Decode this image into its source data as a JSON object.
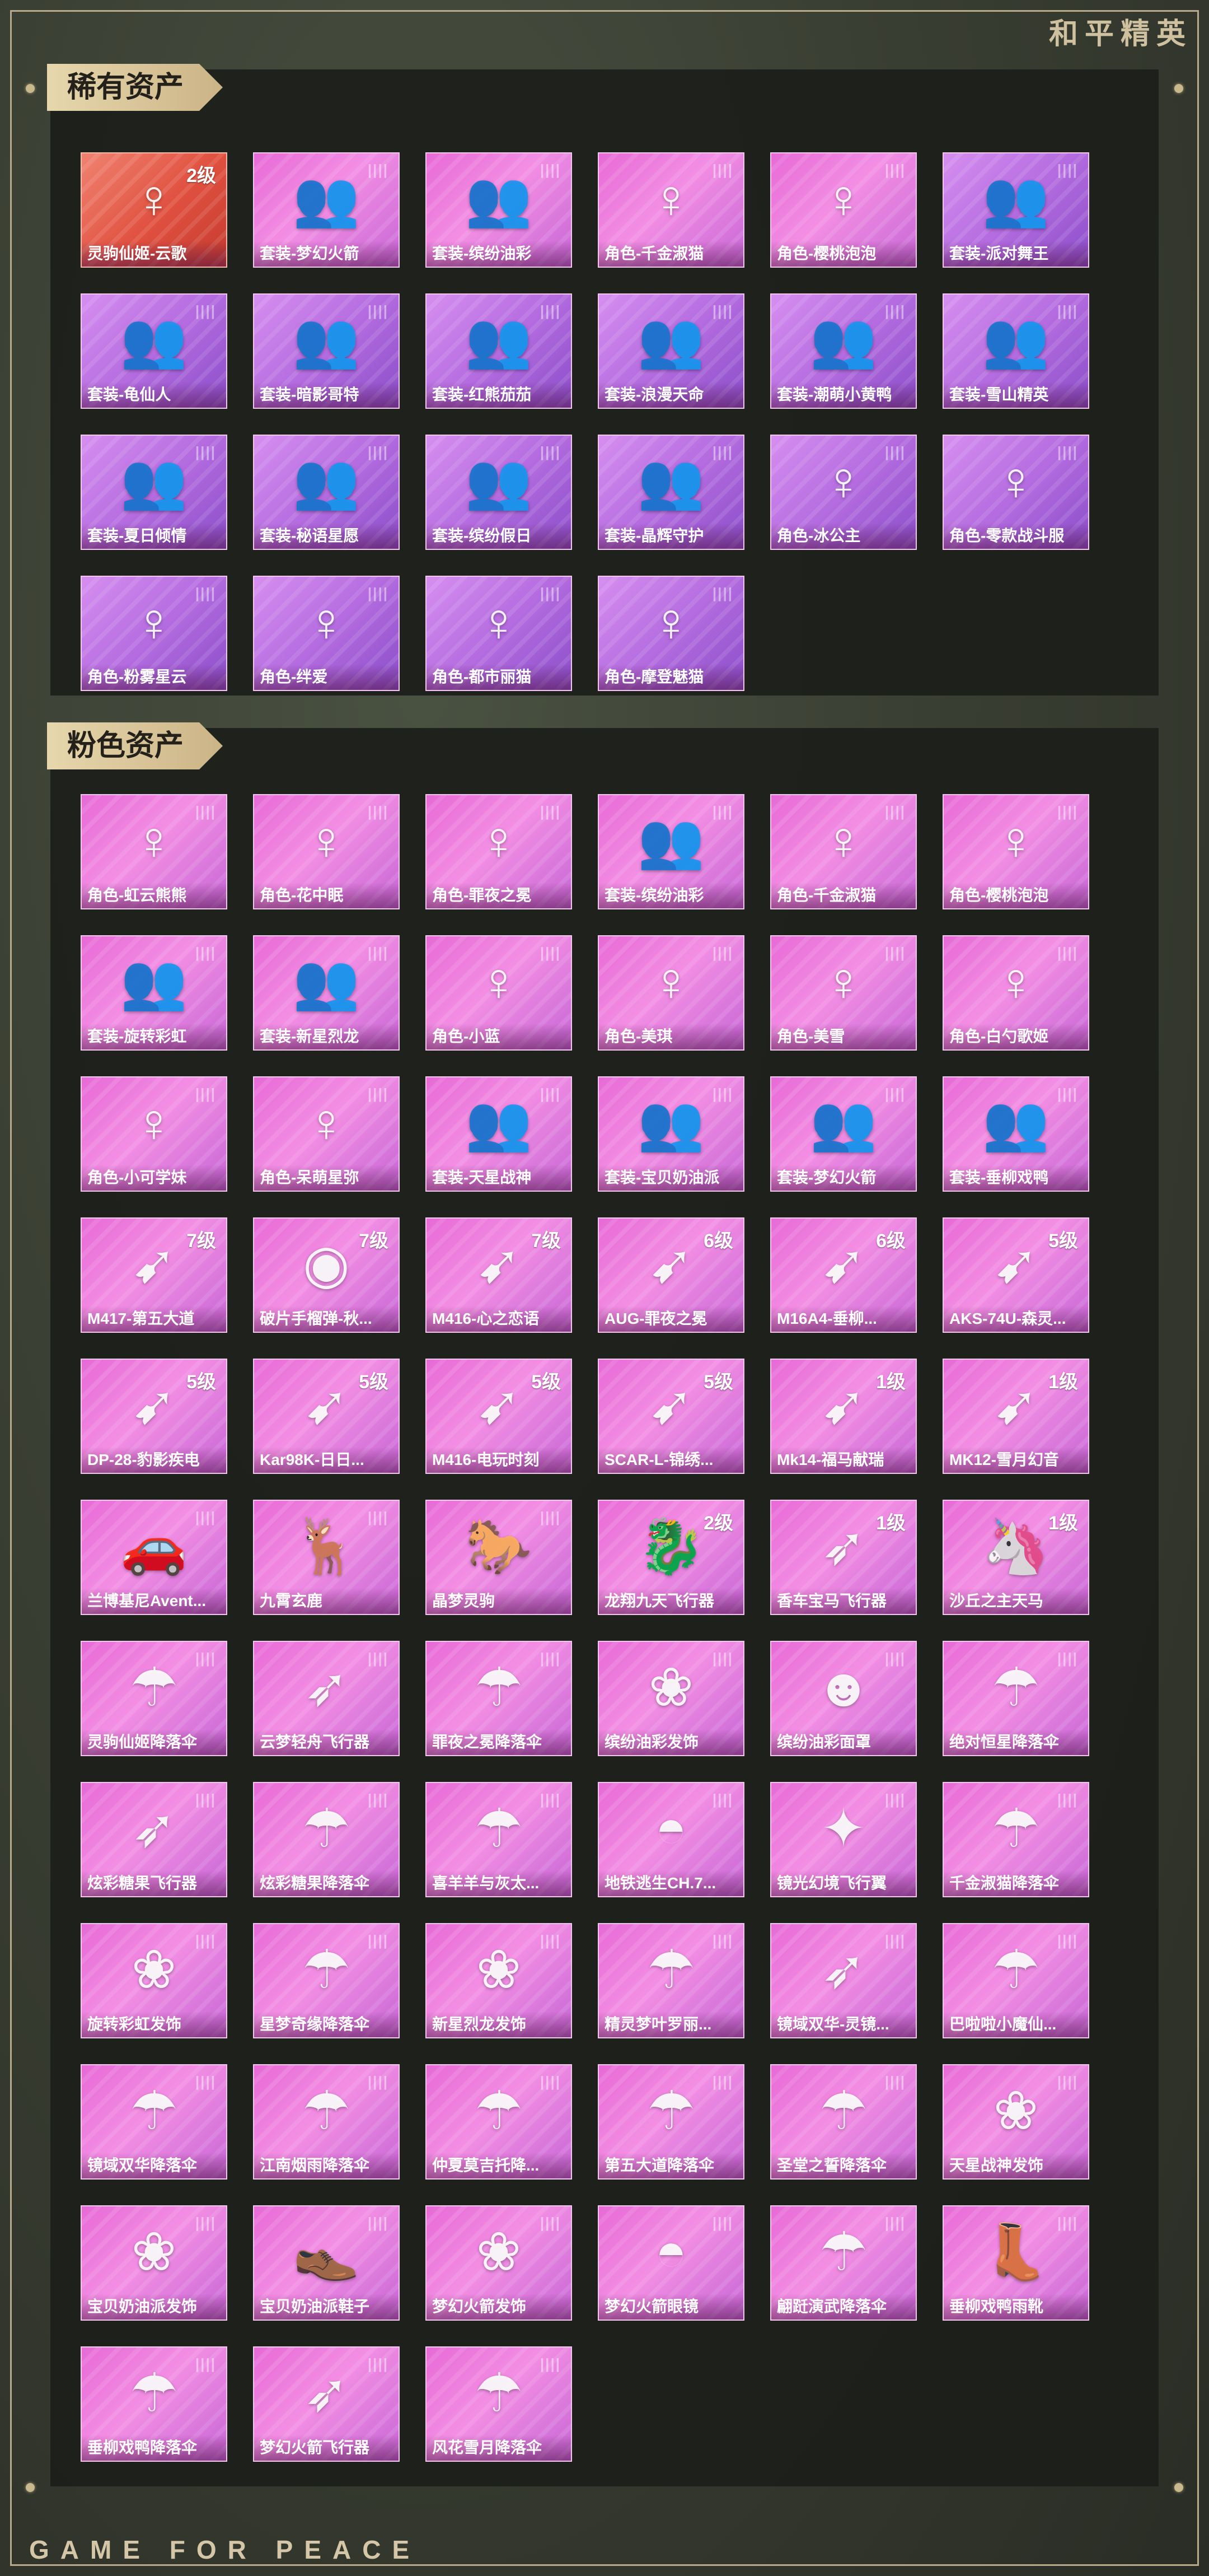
{
  "header": {
    "brand": "和平精英"
  },
  "footer": {
    "text": "GAME FOR PEACE"
  },
  "sections": {
    "rare": {
      "title": "稀有资产",
      "items": [
        {
          "label": "灵驹仙姬-云歌",
          "level": "2级",
          "variant": "red",
          "icon": "character-icon"
        },
        {
          "label": "套装-梦幻火箭",
          "level": "",
          "variant": "pink",
          "icon": "outfit-icon"
        },
        {
          "label": "套装-缤纷油彩",
          "level": "",
          "variant": "pink",
          "icon": "outfit-icon"
        },
        {
          "label": "角色-千金淑猫",
          "level": "",
          "variant": "pink",
          "icon": "character-icon"
        },
        {
          "label": "角色-樱桃泡泡",
          "level": "",
          "variant": "pink",
          "icon": "character-icon"
        },
        {
          "label": "套装-派对舞王",
          "level": "",
          "variant": "purple",
          "icon": "outfit-icon"
        },
        {
          "label": "套装-龟仙人",
          "level": "",
          "variant": "purple",
          "icon": "outfit-icon"
        },
        {
          "label": "套装-暗影哥特",
          "level": "",
          "variant": "purple",
          "icon": "outfit-icon"
        },
        {
          "label": "套装-红熊茄茄",
          "level": "",
          "variant": "purple",
          "icon": "outfit-icon"
        },
        {
          "label": "套装-浪漫天命",
          "level": "",
          "variant": "purple",
          "icon": "outfit-icon"
        },
        {
          "label": "套装-潮萌小黄鸭",
          "level": "",
          "variant": "purple",
          "icon": "outfit-icon"
        },
        {
          "label": "套装-雪山精英",
          "level": "",
          "variant": "purple",
          "icon": "outfit-icon"
        },
        {
          "label": "套装-夏日倾情",
          "level": "",
          "variant": "purple",
          "icon": "outfit-icon"
        },
        {
          "label": "套装-秘语星愿",
          "level": "",
          "variant": "purple",
          "icon": "outfit-icon"
        },
        {
          "label": "套装-缤纷假日",
          "level": "",
          "variant": "purple",
          "icon": "outfit-icon"
        },
        {
          "label": "套装-晶辉守护",
          "level": "",
          "variant": "purple",
          "icon": "outfit-icon"
        },
        {
          "label": "角色-冰公主",
          "level": "",
          "variant": "purple",
          "icon": "character-icon"
        },
        {
          "label": "角色-零款战斗服",
          "level": "",
          "variant": "purple",
          "icon": "character-icon"
        },
        {
          "label": "角色-粉雾星云",
          "level": "",
          "variant": "purple",
          "icon": "character-icon"
        },
        {
          "label": "角色-绊爱",
          "level": "",
          "variant": "purple",
          "icon": "character-icon"
        },
        {
          "label": "角色-都市丽猫",
          "level": "",
          "variant": "purple",
          "icon": "character-icon"
        },
        {
          "label": "角色-摩登魅猫",
          "level": "",
          "variant": "purple",
          "icon": "character-icon"
        }
      ]
    },
    "pink": {
      "title": "粉色资产",
      "items": [
        {
          "label": "角色-虹云熊熊",
          "level": "",
          "variant": "pink",
          "icon": "character-icon"
        },
        {
          "label": "角色-花中眠",
          "level": "",
          "variant": "pink",
          "icon": "character-icon"
        },
        {
          "label": "角色-罪夜之冕",
          "level": "",
          "variant": "pink",
          "icon": "character-icon"
        },
        {
          "label": "套装-缤纷油彩",
          "level": "",
          "variant": "pink",
          "icon": "outfit-icon"
        },
        {
          "label": "角色-千金淑猫",
          "level": "",
          "variant": "pink",
          "icon": "character-icon"
        },
        {
          "label": "角色-樱桃泡泡",
          "level": "",
          "variant": "pink",
          "icon": "character-icon"
        },
        {
          "label": "套装-旋转彩虹",
          "level": "",
          "variant": "pink",
          "icon": "outfit-icon"
        },
        {
          "label": "套装-新星烈龙",
          "level": "",
          "variant": "pink",
          "icon": "outfit-icon"
        },
        {
          "label": "角色-小蓝",
          "level": "",
          "variant": "pink",
          "icon": "character-icon"
        },
        {
          "label": "角色-美琪",
          "level": "",
          "variant": "pink",
          "icon": "character-icon"
        },
        {
          "label": "角色-美雪",
          "level": "",
          "variant": "pink",
          "icon": "character-icon"
        },
        {
          "label": "角色-白勺歌姬",
          "level": "",
          "variant": "pink",
          "icon": "character-icon"
        },
        {
          "label": "角色-小可学妹",
          "level": "",
          "variant": "pink",
          "icon": "character-icon"
        },
        {
          "label": "角色-呆萌星弥",
          "level": "",
          "variant": "pink",
          "icon": "character-icon"
        },
        {
          "label": "套装-天星战神",
          "level": "",
          "variant": "pink",
          "icon": "outfit-icon"
        },
        {
          "label": "套装-宝贝奶油派",
          "level": "",
          "variant": "pink",
          "icon": "outfit-icon"
        },
        {
          "label": "套装-梦幻火箭",
          "level": "",
          "variant": "pink",
          "icon": "outfit-icon"
        },
        {
          "label": "套装-垂柳戏鸭",
          "level": "",
          "variant": "pink",
          "icon": "outfit-icon"
        },
        {
          "label": "M417-第五大道",
          "level": "7级",
          "variant": "pink",
          "icon": "rifle-icon"
        },
        {
          "label": "破片手榴弹-秋...",
          "level": "7级",
          "variant": "pink",
          "icon": "grenade-icon"
        },
        {
          "label": "M416-心之恋语",
          "level": "7级",
          "variant": "pink",
          "icon": "rifle-icon"
        },
        {
          "label": "AUG-罪夜之冕",
          "level": "6级",
          "variant": "pink",
          "icon": "rifle-icon"
        },
        {
          "label": "M16A4-垂柳...",
          "level": "6级",
          "variant": "pink",
          "icon": "rifle-icon"
        },
        {
          "label": "AKS-74U-森灵...",
          "level": "5级",
          "variant": "pink",
          "icon": "rifle-icon"
        },
        {
          "label": "DP-28-豹影疾电",
          "level": "5级",
          "variant": "pink",
          "icon": "rifle-icon"
        },
        {
          "label": "Kar98K-日日...",
          "level": "5级",
          "variant": "pink",
          "icon": "rifle-icon"
        },
        {
          "label": "M416-电玩时刻",
          "level": "5级",
          "variant": "pink",
          "icon": "rifle-icon"
        },
        {
          "label": "SCAR-L-锦绣...",
          "level": "5级",
          "variant": "pink",
          "icon": "rifle-icon"
        },
        {
          "label": "Mk14-福马献瑞",
          "level": "1级",
          "variant": "pink",
          "icon": "rifle-icon"
        },
        {
          "label": "MK12-雪月幻音",
          "level": "1级",
          "variant": "pink",
          "icon": "rifle-icon"
        },
        {
          "label": "兰博基尼Avent...",
          "level": "",
          "variant": "pink",
          "icon": "car-icon"
        },
        {
          "label": "九霄玄鹿",
          "level": "",
          "variant": "pink",
          "icon": "deer-icon"
        },
        {
          "label": "晶梦灵驹",
          "level": "",
          "variant": "pink",
          "icon": "horse-icon"
        },
        {
          "label": "龙翔九天飞行器",
          "level": "2级",
          "variant": "pink",
          "icon": "dragon-icon"
        },
        {
          "label": "香车宝马飞行器",
          "level": "1级",
          "variant": "pink",
          "icon": "glider-icon"
        },
        {
          "label": "沙丘之主天马",
          "level": "1级",
          "variant": "pink",
          "icon": "pegasus-icon"
        },
        {
          "label": "灵驹仙姬降落伞",
          "level": "",
          "variant": "pink",
          "icon": "parachute-icon"
        },
        {
          "label": "云梦轻舟飞行器",
          "level": "",
          "variant": "pink",
          "icon": "glider-icon"
        },
        {
          "label": "罪夜之冕降落伞",
          "level": "",
          "variant": "pink",
          "icon": "parachute-icon"
        },
        {
          "label": "缤纷油彩发饰",
          "level": "",
          "variant": "pink",
          "icon": "hair-accessory-icon"
        },
        {
          "label": "缤纷油彩面罩",
          "level": "",
          "variant": "pink",
          "icon": "mask-icon"
        },
        {
          "label": "绝对恒星降落伞",
          "level": "",
          "variant": "pink",
          "icon": "parachute-icon"
        },
        {
          "label": "炫彩糖果飞行器",
          "level": "",
          "variant": "pink",
          "icon": "glider-icon"
        },
        {
          "label": "炫彩糖果降落伞",
          "level": "",
          "variant": "pink",
          "icon": "parachute-icon"
        },
        {
          "label": "喜羊羊与灰太...",
          "level": "",
          "variant": "pink",
          "icon": "parachute-icon"
        },
        {
          "label": "地铁逃生CH.7...",
          "level": "",
          "variant": "pink",
          "icon": "goggles-icon"
        },
        {
          "label": "镜光幻境飞行翼",
          "level": "",
          "variant": "pink",
          "icon": "wing-icon"
        },
        {
          "label": "千金淑猫降落伞",
          "level": "",
          "variant": "pink",
          "icon": "parachute-icon"
        },
        {
          "label": "旋转彩虹发饰",
          "level": "",
          "variant": "pink",
          "icon": "hair-accessory-icon"
        },
        {
          "label": "星梦奇缘降落伞",
          "level": "",
          "variant": "pink",
          "icon": "parachute-icon"
        },
        {
          "label": "新星烈龙发饰",
          "level": "",
          "variant": "pink",
          "icon": "hair-accessory-icon"
        },
        {
          "label": "精灵梦叶罗丽...",
          "level": "",
          "variant": "pink",
          "icon": "parachute-icon"
        },
        {
          "label": "镜域双华-灵镜...",
          "level": "",
          "variant": "pink",
          "icon": "glider-icon"
        },
        {
          "label": "巴啦啦小魔仙...",
          "level": "",
          "variant": "pink",
          "icon": "parachute-icon"
        },
        {
          "label": "镜域双华降落伞",
          "level": "",
          "variant": "pink",
          "icon": "parachute-icon"
        },
        {
          "label": "江南烟雨降落伞",
          "level": "",
          "variant": "pink",
          "icon": "parachute-icon"
        },
        {
          "label": "仲夏莫吉托降...",
          "level": "",
          "variant": "pink",
          "icon": "parachute-icon"
        },
        {
          "label": "第五大道降落伞",
          "level": "",
          "variant": "pink",
          "icon": "parachute-icon"
        },
        {
          "label": "圣堂之誓降落伞",
          "level": "",
          "variant": "pink",
          "icon": "parachute-icon"
        },
        {
          "label": "天星战神发饰",
          "level": "",
          "variant": "pink",
          "icon": "hair-accessory-icon"
        },
        {
          "label": "宝贝奶油派发饰",
          "level": "",
          "variant": "pink",
          "icon": "hair-accessory-icon"
        },
        {
          "label": "宝贝奶油派鞋子",
          "level": "",
          "variant": "pink",
          "icon": "shoes-icon"
        },
        {
          "label": "梦幻火箭发饰",
          "level": "",
          "variant": "pink",
          "icon": "hair-accessory-icon"
        },
        {
          "label": "梦幻火箭眼镜",
          "level": "",
          "variant": "pink",
          "icon": "goggles-icon"
        },
        {
          "label": "翩跹演武降落伞",
          "level": "",
          "variant": "pink",
          "icon": "parachute-icon"
        },
        {
          "label": "垂柳戏鸭雨靴",
          "level": "",
          "variant": "pink",
          "icon": "boots-icon"
        },
        {
          "label": "垂柳戏鸭降落伞",
          "level": "",
          "variant": "pink",
          "icon": "parachute-icon"
        },
        {
          "label": "梦幻火箭飞行器",
          "level": "",
          "variant": "pink",
          "icon": "glider-icon"
        },
        {
          "label": "风花雪月降落伞",
          "level": "",
          "variant": "pink",
          "icon": "parachute-icon"
        }
      ]
    }
  }
}
